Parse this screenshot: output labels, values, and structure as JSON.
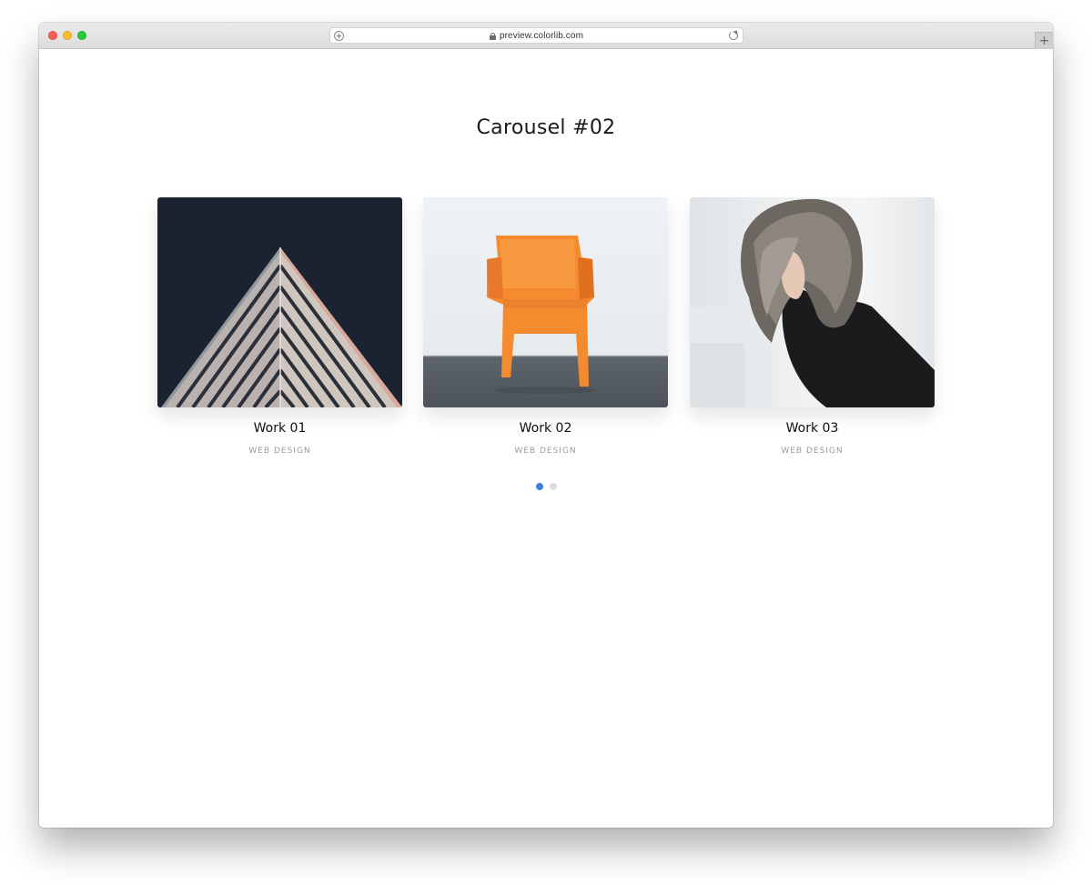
{
  "browser": {
    "url": "preview.colorlib.com",
    "new_tab_label": "+"
  },
  "page": {
    "title": "Carousel #02"
  },
  "carousel": {
    "items": [
      {
        "title": "Work 01",
        "category": "WEB DESIGN",
        "image": "geometric-building"
      },
      {
        "title": "Work 02",
        "category": "WEB DESIGN",
        "image": "orange-chair"
      },
      {
        "title": "Work 03",
        "category": "WEB DESIGN",
        "image": "woman-portrait"
      }
    ],
    "pagination": {
      "total": 2,
      "active": 1
    }
  },
  "colors": {
    "accent": "#3b82e0",
    "inactive_dot": "#dcdcdc",
    "category_text": "#9a9a9a"
  }
}
